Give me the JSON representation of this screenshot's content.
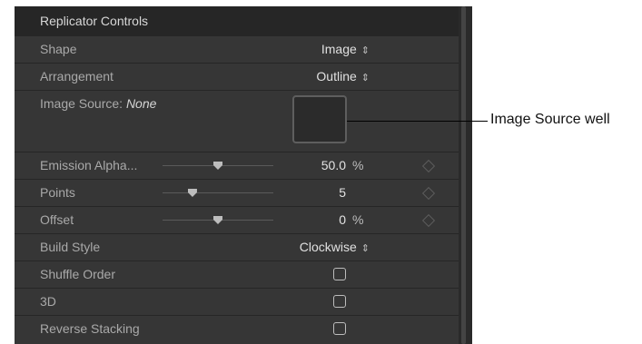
{
  "panel": {
    "title": "Replicator Controls"
  },
  "rows": {
    "shape": {
      "label": "Shape",
      "value": "Image"
    },
    "arrangement": {
      "label": "Arrangement",
      "value": "Outline"
    },
    "image_source": {
      "label_prefix": "Image Source: ",
      "label_value": "None"
    },
    "emission_alpha": {
      "label": "Emission Alpha...",
      "value": "50.0",
      "unit": "%",
      "slider_fraction": 0.5
    },
    "points": {
      "label": "Points",
      "value": "5",
      "slider_fraction": 0.27
    },
    "offset": {
      "label": "Offset",
      "value": "0",
      "unit": "%",
      "slider_fraction": 0.5
    },
    "build_style": {
      "label": "Build Style",
      "value": "Clockwise"
    },
    "shuffle_order": {
      "label": "Shuffle Order",
      "checked": false
    },
    "three_d": {
      "label": "3D",
      "checked": false
    },
    "reverse_stacking": {
      "label": "Reverse Stacking",
      "checked": false
    }
  },
  "callout": {
    "text": "Image Source well"
  },
  "icons": {
    "popup": "up-down-chevron-icon",
    "keyframe": "diamond-keyframe-icon",
    "checkbox": "checkbox-icon"
  }
}
